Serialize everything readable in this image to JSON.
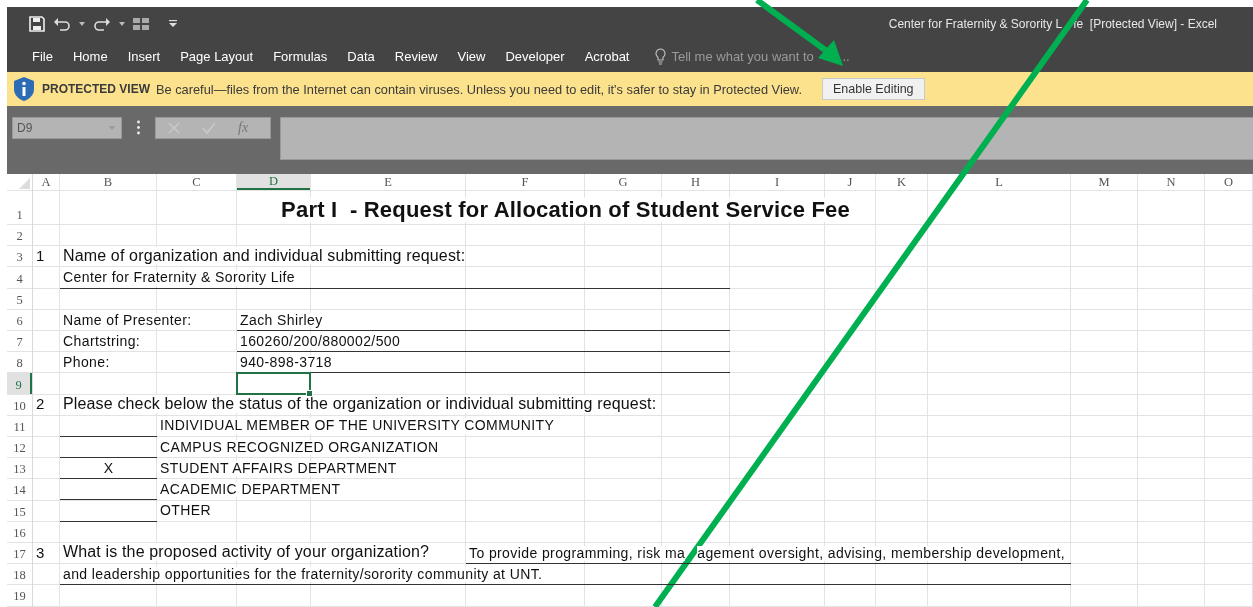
{
  "window": {
    "title_parts": [
      "Center for Fraternity & Sorority L",
      "fe  [Protected View] - Excel"
    ]
  },
  "ribbon": {
    "tabs": [
      {
        "label": "File"
      },
      {
        "label": "Home"
      },
      {
        "label": "Insert"
      },
      {
        "label": "Page Layout"
      },
      {
        "label": "Formulas"
      },
      {
        "label": "Data"
      },
      {
        "label": "Review"
      },
      {
        "label": "View"
      },
      {
        "label": "Developer"
      },
      {
        "label": "Acrobat"
      }
    ],
    "tell_me": {
      "placeholder_parts": [
        "Tell me what you want to",
        "..."
      ]
    }
  },
  "protected_view": {
    "label": "PROTECTED VIEW",
    "message": "Be careful—files from the Internet can contain viruses. Unless you need to edit, it's safer to stay in Protected View.",
    "button": "Enable Editing"
  },
  "formula_bar": {
    "name_box": "D9",
    "function_label": "fx"
  },
  "sheet": {
    "columns": [
      {
        "label": "A",
        "selected": false
      },
      {
        "label": "B",
        "selected": false
      },
      {
        "label": "C",
        "selected": false
      },
      {
        "label": "D",
        "selected": true
      },
      {
        "label": "E",
        "selected": false
      },
      {
        "label": "F",
        "selected": false
      },
      {
        "label": "G",
        "selected": false
      },
      {
        "label": "H",
        "selected": false
      },
      {
        "label": "I",
        "selected": false
      },
      {
        "label": "J",
        "selected": false
      },
      {
        "label": "K",
        "selected": false
      },
      {
        "label": "L",
        "selected": false
      },
      {
        "label": "M",
        "selected": false
      },
      {
        "label": "N",
        "selected": false
      },
      {
        "label": "O",
        "selected": false
      }
    ],
    "rows": [
      {
        "number": "1",
        "selected": false,
        "cells": [
          {
            "text": "",
            "kind": "blank"
          },
          {
            "text": "Part I  - Request for Allocation of Student Service Fee",
            "kind": "title"
          }
        ]
      },
      {
        "number": "2",
        "selected": false
      },
      {
        "number": "3",
        "selected": false,
        "cells": [
          {
            "text": "1",
            "kind": "number"
          },
          {
            "text": "Name of organization and individual submitting request:",
            "kind": "question"
          }
        ]
      },
      {
        "number": "4",
        "selected": false,
        "cells": [
          {
            "text": "",
            "kind": "blank"
          },
          {
            "text": "Center for Fraternity & Sorority Life",
            "kind": "text",
            "underlined": true
          },
          {
            "text": "",
            "kind": "blank",
            "underlined": true
          },
          {
            "text": "",
            "kind": "blank",
            "underlined": true
          },
          {
            "text": "",
            "kind": "blank",
            "underlined": true
          },
          {
            "text": "",
            "kind": "blank",
            "underlined": true
          },
          {
            "text": "",
            "kind": "blank",
            "underlined": true
          },
          {
            "text": "",
            "kind": "blank",
            "underlined": true
          }
        ]
      },
      {
        "number": "5",
        "selected": false
      },
      {
        "number": "6",
        "selected": false,
        "cells": [
          {
            "text": "",
            "kind": "blank"
          },
          {
            "text": "Name of Presenter:",
            "kind": "text"
          },
          {
            "text": "",
            "kind": "blank"
          },
          {
            "text": "Zach Shirley",
            "kind": "text",
            "underlined": true
          },
          {
            "text": "",
            "kind": "blank",
            "underlined": true
          },
          {
            "text": "",
            "kind": "blank",
            "underlined": true
          },
          {
            "text": "",
            "kind": "blank",
            "underlined": true
          },
          {
            "text": "",
            "kind": "blank",
            "underlined": true
          }
        ]
      },
      {
        "number": "7",
        "selected": false,
        "cells": [
          {
            "text": "",
            "kind": "blank"
          },
          {
            "text": "Chartstring:",
            "kind": "text"
          },
          {
            "text": "",
            "kind": "blank"
          },
          {
            "text": "160260/200/880002/500",
            "kind": "text",
            "underlined": true
          },
          {
            "text": "",
            "kind": "blank",
            "underlined": true
          },
          {
            "text": "",
            "kind": "blank",
            "underlined": true
          },
          {
            "text": "",
            "kind": "blank",
            "underlined": true
          },
          {
            "text": "",
            "kind": "blank",
            "underlined": true
          }
        ]
      },
      {
        "number": "8",
        "selected": false,
        "cells": [
          {
            "text": "",
            "kind": "blank"
          },
          {
            "text": "Phone:",
            "kind": "text"
          },
          {
            "text": "",
            "kind": "blank"
          },
          {
            "text": "940-898-3718",
            "kind": "text",
            "underlined": true
          },
          {
            "text": "",
            "kind": "blank",
            "underlined": true
          },
          {
            "text": "",
            "kind": "blank",
            "underlined": true
          },
          {
            "text": "",
            "kind": "blank",
            "underlined": true
          },
          {
            "text": "",
            "kind": "blank",
            "underlined": true
          }
        ]
      },
      {
        "number": "9",
        "selected": true
      },
      {
        "number": "10",
        "selected": false,
        "cells": [
          {
            "text": "2",
            "kind": "number"
          },
          {
            "text": "Please check below the status of the organization or individual submitting request:",
            "kind": "question"
          }
        ]
      },
      {
        "number": "11",
        "selected": false,
        "cells": [
          {
            "text": "",
            "kind": "blank"
          },
          {
            "text": "",
            "kind": "blank",
            "underlined": true
          },
          {
            "text": "INDIVIDUAL MEMBER OF THE UNIVERSITY COMMUNITY",
            "kind": "text"
          }
        ]
      },
      {
        "number": "12",
        "selected": false,
        "cells": [
          {
            "text": "",
            "kind": "blank"
          },
          {
            "text": "",
            "kind": "blank",
            "underlined": true
          },
          {
            "text": "CAMPUS RECOGNIZED ORGANIZATION",
            "kind": "text"
          }
        ]
      },
      {
        "number": "13",
        "selected": false,
        "cells": [
          {
            "text": "",
            "kind": "blank"
          },
          {
            "text": "X",
            "kind": "mark",
            "underlined": true
          },
          {
            "text": "STUDENT AFFAIRS DEPARTMENT",
            "kind": "text"
          }
        ]
      },
      {
        "number": "14",
        "selected": false,
        "cells": [
          {
            "text": "",
            "kind": "blank"
          },
          {
            "text": "",
            "kind": "blank",
            "underlined": true
          },
          {
            "text": "ACADEMIC DEPARTMENT",
            "kind": "text"
          }
        ]
      },
      {
        "number": "15",
        "selected": false,
        "cells": [
          {
            "text": "",
            "kind": "blank"
          },
          {
            "text": "",
            "kind": "blank",
            "underlined": true
          },
          {
            "text": "OTHER",
            "kind": "text"
          }
        ]
      },
      {
        "number": "16",
        "selected": false
      },
      {
        "number": "17",
        "selected": false,
        "cells": [
          {
            "text": "3",
            "kind": "number"
          },
          {
            "text": "What is the proposed activity of your organization?",
            "kind": "question"
          },
          {
            "text": "",
            "kind": "blank"
          },
          {
            "text": "",
            "kind": "blank"
          },
          {
            "text": "",
            "kind": "blank"
          },
          {
            "text": "To provide programming, risk ma",
            "text_continued": "agement oversight, advising, membership development,",
            "kind": "text",
            "underlined": true
          },
          {
            "text": "",
            "kind": "blank",
            "underlined": true
          },
          {
            "text": "",
            "kind": "blank",
            "underlined": true
          },
          {
            "text": "",
            "kind": "blank",
            "underlined": true
          },
          {
            "text": "",
            "kind": "blank",
            "underlined": true
          },
          {
            "text": "",
            "kind": "blank",
            "underlined": true
          },
          {
            "text": "",
            "kind": "blank",
            "underlined": true
          }
        ]
      },
      {
        "number": "18",
        "selected": false,
        "cells": [
          {
            "text": "",
            "kind": "blank"
          },
          {
            "text": "and leadership opportunities for the fraternity/sorority community at UNT.",
            "kind": "text",
            "underlined": true
          },
          {
            "text": "",
            "kind": "blank",
            "underlined": true
          },
          {
            "text": "",
            "kind": "blank",
            "underlined": true
          },
          {
            "text": "",
            "kind": "blank",
            "underlined": true
          },
          {
            "text": "",
            "kind": "blank",
            "underlined": true
          },
          {
            "text": "",
            "kind": "blank",
            "underlined": true
          },
          {
            "text": "",
            "kind": "blank",
            "underlined": true
          },
          {
            "text": "",
            "kind": "blank",
            "underlined": true
          },
          {
            "text": "",
            "kind": "blank",
            "underlined": true
          },
          {
            "text": "",
            "kind": "blank",
            "underlined": true
          },
          {
            "text": "",
            "kind": "blank",
            "underlined": true
          }
        ]
      },
      {
        "number": "19",
        "selected": false
      }
    ]
  }
}
